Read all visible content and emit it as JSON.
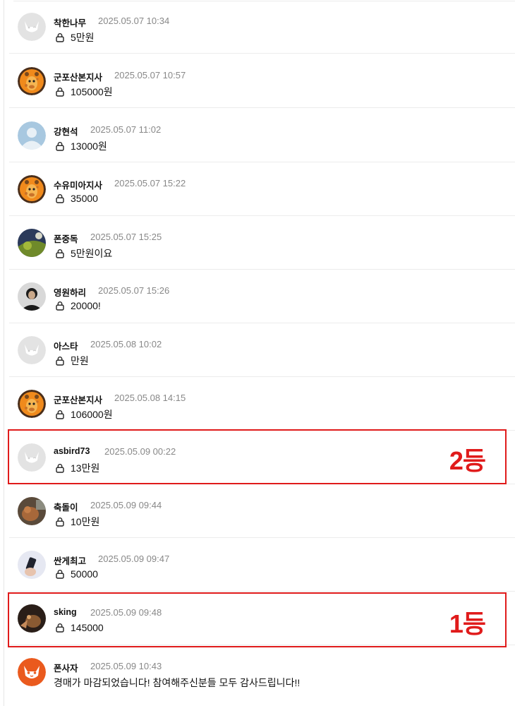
{
  "comments": [
    {
      "name": "착한나무",
      "time": "2025.05.07 10:34",
      "content": "5만원",
      "locked": true,
      "avatar": "cat"
    },
    {
      "name": "군포산본지사",
      "time": "2025.05.07 10:57",
      "content": "105000원",
      "locked": true,
      "avatar": "giraffe"
    },
    {
      "name": "강현석",
      "time": "2025.05.07 11:02",
      "content": "13000원",
      "locked": true,
      "avatar": "person"
    },
    {
      "name": "수유미아지사",
      "time": "2025.05.07 15:22",
      "content": "35000",
      "locked": true,
      "avatar": "giraffe"
    },
    {
      "name": "폰중독",
      "time": "2025.05.07 15:25",
      "content": "5만원이요",
      "locked": true,
      "avatar": "photo-ball"
    },
    {
      "name": "영원하리",
      "time": "2025.05.07 15:26",
      "content": "20000!",
      "locked": true,
      "avatar": "photo-man"
    },
    {
      "name": "아스타",
      "time": "2025.05.08 10:02",
      "content": "만원",
      "locked": true,
      "avatar": "cat"
    },
    {
      "name": "군포산본지사",
      "time": "2025.05.08 14:15",
      "content": "106000원",
      "locked": true,
      "avatar": "giraffe"
    },
    {
      "name": "asbird73",
      "time": "2025.05.09 00:22",
      "content": "13만원",
      "locked": true,
      "avatar": "cat"
    },
    {
      "name": "축돌이",
      "time": "2025.05.09 09:44",
      "content": "10만원",
      "locked": true,
      "avatar": "photo-dog"
    },
    {
      "name": "싼게최고",
      "time": "2025.05.09 09:47",
      "content": "50000",
      "locked": true,
      "avatar": "photo-phone"
    },
    {
      "name": "sking",
      "time": "2025.05.09 09:48",
      "content": "145000",
      "locked": true,
      "avatar": "photo-cat"
    },
    {
      "name": "폰사자",
      "time": "2025.05.09 10:43",
      "content": "경매가 마감되었습니다! 참여해주신분들 모두 감사드립니다!!",
      "locked": false,
      "avatar": "cat-orange"
    }
  ],
  "highlights": [
    {
      "comment_index": 8,
      "label": "2등"
    },
    {
      "comment_index": 11,
      "label": "1등"
    }
  ],
  "colors": {
    "highlight": "#e01b1b",
    "timestamp": "#888888",
    "separator": "#ececec"
  }
}
